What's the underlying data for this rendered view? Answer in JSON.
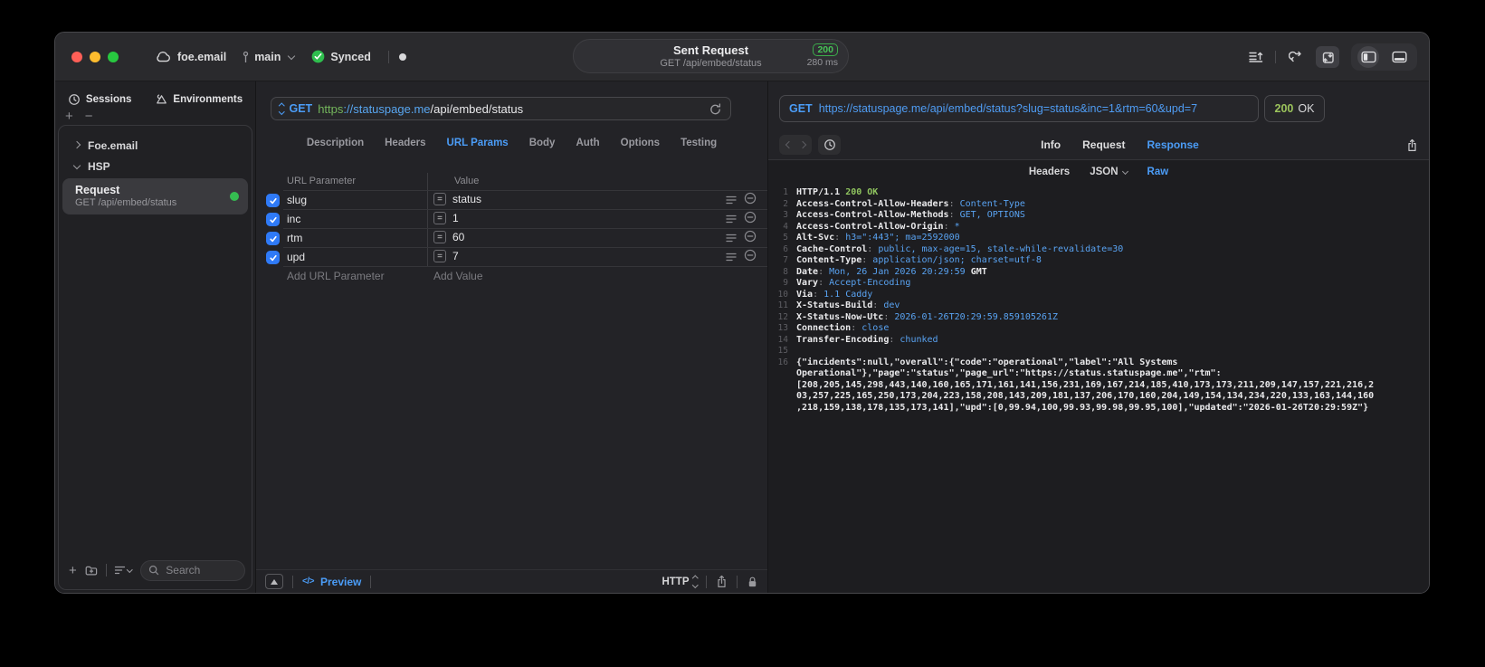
{
  "titlebar": {
    "project": "foe.email",
    "branch": "main",
    "synced": "Synced",
    "request_title": "Sent Request",
    "request_subtitle": "GET /api/embed/status",
    "status_code": "200",
    "duration": "280 ms"
  },
  "sidebar": {
    "tabs": [
      {
        "label": "Sessions",
        "active": true
      },
      {
        "label": "Environments",
        "active": false
      }
    ],
    "groups": [
      {
        "label": "Foe.email",
        "expanded": false
      },
      {
        "label": "HSP",
        "expanded": true
      }
    ],
    "request_item": {
      "title": "Request",
      "subtitle": "GET /api/embed/status"
    },
    "search_placeholder": "Search"
  },
  "request_editor": {
    "method": "GET",
    "url_scheme": "https",
    "url_host": "://statuspage.me",
    "url_path": "/api/embed/status",
    "tabs": [
      {
        "label": "Description"
      },
      {
        "label": "Headers"
      },
      {
        "label": "URL Params",
        "active": true
      },
      {
        "label": "Body"
      },
      {
        "label": "Auth"
      },
      {
        "label": "Options"
      },
      {
        "label": "Testing"
      }
    ],
    "param_table": {
      "col_name": "URL Parameter",
      "col_value": "Value",
      "rows": [
        {
          "name": "slug",
          "value": "status",
          "enabled": true
        },
        {
          "name": "inc",
          "value": "1",
          "enabled": true
        },
        {
          "name": "rtm",
          "value": "60",
          "enabled": true
        },
        {
          "name": "upd",
          "value": "7",
          "enabled": true
        }
      ],
      "add_name": "Add URL Parameter",
      "add_value": "Add Value"
    },
    "footer": {
      "code_glyph": "</>",
      "preview": "Preview",
      "protocol": "HTTP"
    }
  },
  "response_viewer": {
    "method": "GET",
    "url": "https://statuspage.me/api/embed/status?slug=status&inc=1&rtm=60&upd=7",
    "status_code": "200",
    "status_text": "OK",
    "tabs": [
      {
        "label": "Info"
      },
      {
        "label": "Request"
      },
      {
        "label": "Response",
        "active": true
      }
    ],
    "subtabs": [
      {
        "label": "Headers"
      },
      {
        "label": "JSON",
        "chevron": true
      },
      {
        "label": "Raw",
        "active": true
      }
    ],
    "raw_lines": [
      {
        "num": "1",
        "segments": [
          {
            "t": "HTTP/1.1 ",
            "c": "w"
          },
          {
            "t": "200 OK",
            "c": "g"
          }
        ]
      },
      {
        "num": "2",
        "segments": [
          {
            "t": "Access-Control-Allow-Headers",
            "c": "w"
          },
          {
            "t": ": ",
            "c": "d"
          },
          {
            "t": "Content-Type",
            "c": "b"
          }
        ]
      },
      {
        "num": "3",
        "segments": [
          {
            "t": "Access-Control-Allow-Methods",
            "c": "w"
          },
          {
            "t": ": ",
            "c": "d"
          },
          {
            "t": "GET, OPTIONS",
            "c": "b"
          }
        ]
      },
      {
        "num": "4",
        "segments": [
          {
            "t": "Access-Control-Allow-Origin",
            "c": "w"
          },
          {
            "t": ": ",
            "c": "d"
          },
          {
            "t": "*",
            "c": "b"
          }
        ]
      },
      {
        "num": "5",
        "segments": [
          {
            "t": "Alt-Svc",
            "c": "w"
          },
          {
            "t": ": ",
            "c": "d"
          },
          {
            "t": "h3=\":443\"; ma=2592000",
            "c": "b"
          }
        ]
      },
      {
        "num": "6",
        "segments": [
          {
            "t": "Cache-Control",
            "c": "w"
          },
          {
            "t": ": ",
            "c": "d"
          },
          {
            "t": "public, max-age=15, stale-while-revalidate=30",
            "c": "b"
          }
        ]
      },
      {
        "num": "7",
        "segments": [
          {
            "t": "Content-Type",
            "c": "w"
          },
          {
            "t": ": ",
            "c": "d"
          },
          {
            "t": "application/json; charset=utf-8",
            "c": "b"
          }
        ]
      },
      {
        "num": "8",
        "segments": [
          {
            "t": "Date",
            "c": "w"
          },
          {
            "t": ": ",
            "c": "d"
          },
          {
            "t": "Mon, 26 Jan 2026 20:29:59 ",
            "c": "b"
          },
          {
            "t": "GMT",
            "c": "w"
          }
        ]
      },
      {
        "num": "9",
        "segments": [
          {
            "t": "Vary",
            "c": "w"
          },
          {
            "t": ": ",
            "c": "d"
          },
          {
            "t": "Accept-Encoding",
            "c": "b"
          }
        ]
      },
      {
        "num": "10",
        "segments": [
          {
            "t": "Via",
            "c": "w"
          },
          {
            "t": ": ",
            "c": "d"
          },
          {
            "t": "1.1 Caddy",
            "c": "b"
          }
        ]
      },
      {
        "num": "11",
        "segments": [
          {
            "t": "X-Status-Build",
            "c": "w"
          },
          {
            "t": ": ",
            "c": "d"
          },
          {
            "t": "dev",
            "c": "b"
          }
        ]
      },
      {
        "num": "12",
        "segments": [
          {
            "t": "X-Status-Now-Utc",
            "c": "w"
          },
          {
            "t": ": ",
            "c": "d"
          },
          {
            "t": "2026-01-26T20:29:59.859105261Z",
            "c": "b"
          }
        ]
      },
      {
        "num": "13",
        "segments": [
          {
            "t": "Connection",
            "c": "w"
          },
          {
            "t": ": ",
            "c": "d"
          },
          {
            "t": "close",
            "c": "b"
          }
        ]
      },
      {
        "num": "14",
        "segments": [
          {
            "t": "Transfer-Encoding",
            "c": "w"
          },
          {
            "t": ": ",
            "c": "d"
          },
          {
            "t": "chunked",
            "c": "b"
          }
        ]
      },
      {
        "num": "15",
        "segments": []
      },
      {
        "num": "16",
        "segments": [
          {
            "t": "{\"incidents\":null,\"overall\":{\"code\":\"operational\",\"label\":\"All Systems Operational\"},\"page\":\"status\",\"page_url\":\"https://status.statuspage.me\",\"rtm\":[208,205,145,298,443,140,160,165,171,161,141,156,231,169,167,214,185,410,173,173,211,209,147,157,221,216,203,257,225,165,250,173,204,223,158,208,143,209,181,137,206,170,160,204,149,154,134,234,220,133,163,144,160,218,159,138,178,135,173,141],\"upd\":[0,99.94,100,99.93,99.98,99.95,100],\"updated\":\"2026-01-26T20:29:59Z\"}",
            "c": "w"
          }
        ]
      }
    ]
  }
}
